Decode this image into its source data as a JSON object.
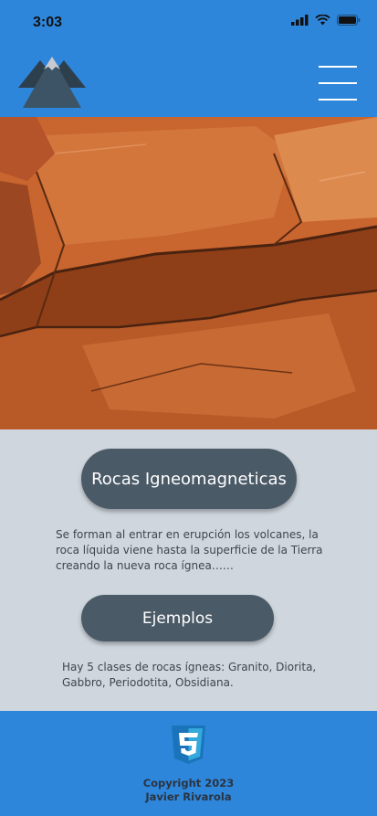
{
  "status_bar": {
    "time": "3:03",
    "icons": [
      "signal-icon",
      "wifi-icon",
      "battery-icon"
    ]
  },
  "header": {
    "logo_icon": "mountain-icon",
    "menu_icon": "hamburger-menu-icon"
  },
  "colors": {
    "primary": "#2e86db",
    "button": "#4b5a67",
    "background": "#cfd6dd"
  },
  "main": {
    "title_button": "Rocas Igneomagneticas",
    "description": "Se forman al entrar en erupción los volcanes, la roca líquida viene hasta la superficie de la Tierra creando la nueva roca ígnea……",
    "examples_button": "Ejemplos",
    "examples_text": "Hay 5 clases de rocas ígneas: Granito, Diorita, Gabbro, Periodotita, Obsidiana."
  },
  "footer": {
    "logo_icon": "css3-icon",
    "copyright_line1": "Copyright 2023",
    "copyright_line2": "Javier Rivarola"
  }
}
